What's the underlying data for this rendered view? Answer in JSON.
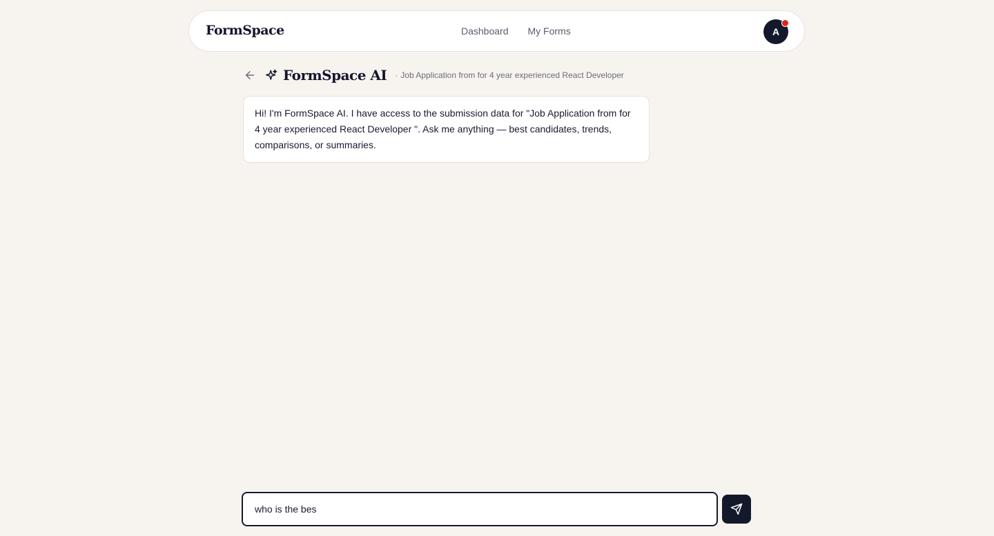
{
  "nav": {
    "brand": "FormSpace",
    "links": [
      "Dashboard",
      "My Forms"
    ],
    "avatar_initial": "A",
    "notification_color": "#e0251b"
  },
  "chat_header": {
    "back_icon": "arrow-left-icon",
    "sparkle_icon": "sparkle-icon",
    "title": "FormSpace AI",
    "separator": "·",
    "subtitle": "Job Application from for 4 year experienced React Developer"
  },
  "messages": [
    {
      "role": "assistant",
      "text": "Hi! I'm FormSpace AI. I have access to the submission data for \"Job Application from for 4 year experienced React Developer \". Ask me anything — best candidates, trends, comparisons, or summaries."
    }
  ],
  "composer": {
    "value": "who is the bes",
    "send_icon": "send-icon"
  },
  "colors": {
    "background": "#f7f4f0",
    "primary": "#14182b",
    "muted_text": "#6b6b78"
  }
}
